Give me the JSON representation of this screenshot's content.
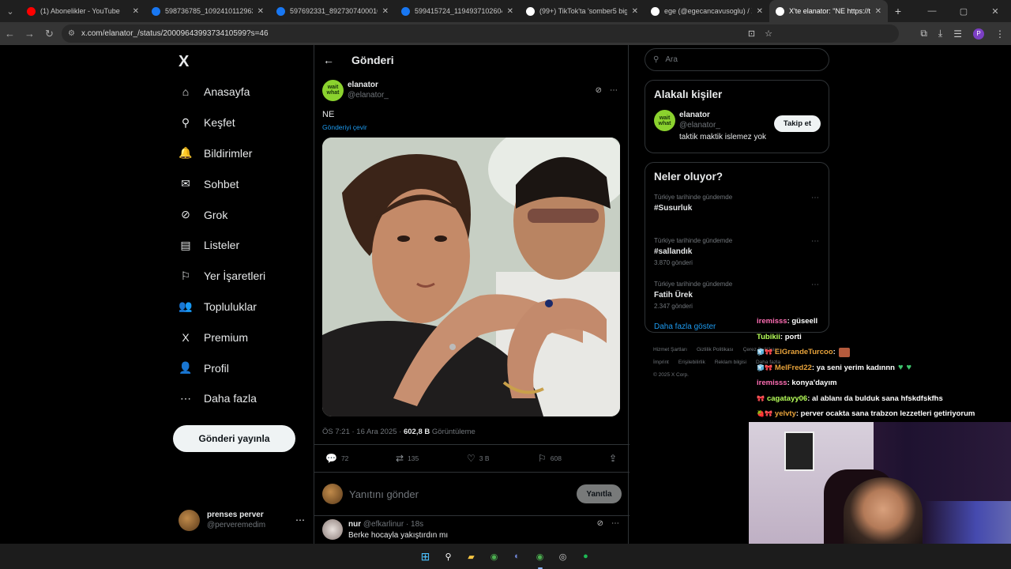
{
  "browser": {
    "tabs": [
      {
        "title": "(1) Abonelikler - YouTube",
        "icon": "youtube-icon",
        "color": "#ff0000",
        "active": false
      },
      {
        "title": "598736785_1092410112963637",
        "icon": "facebook-icon",
        "color": "#1877f2",
        "active": false
      },
      {
        "title": "597692331_8927307400016451",
        "icon": "facebook-icon",
        "color": "#1877f2",
        "active": false
      },
      {
        "title": "599415724_1194937102604271",
        "icon": "facebook-icon",
        "color": "#1877f2",
        "active": false
      },
      {
        "title": "(99+) TikTok'ta 'somber5 big5' s",
        "icon": "tiktok-icon",
        "color": "#ffffff",
        "active": false
      },
      {
        "title": "ege (@egecancavusoglu) / X",
        "icon": "x-icon",
        "color": "#ffffff",
        "active": false
      },
      {
        "title": "X'te elanator: \"NE https://t.co/i",
        "icon": "x-icon",
        "color": "#ffffff",
        "active": true
      }
    ],
    "url": "x.com/elanator_/status/2000964399373410599?s=46",
    "profile_initial": "P"
  },
  "sidebar": {
    "logo": "X",
    "items": [
      {
        "label": "Anasayfa",
        "icon": "home-icon",
        "glyph": "⌂"
      },
      {
        "label": "Keşfet",
        "icon": "search-icon",
        "glyph": "⚲"
      },
      {
        "label": "Bildirimler",
        "icon": "bell-icon",
        "glyph": "🔔"
      },
      {
        "label": "Sohbet",
        "icon": "mail-icon",
        "glyph": "✉"
      },
      {
        "label": "Grok",
        "icon": "grok-icon",
        "glyph": "⊘"
      },
      {
        "label": "Listeler",
        "icon": "list-icon",
        "glyph": "▤"
      },
      {
        "label": "Yer İşaretleri",
        "icon": "bookmark-icon",
        "glyph": "⚐"
      },
      {
        "label": "Topluluklar",
        "icon": "communities-icon",
        "glyph": "👥"
      },
      {
        "label": "Premium",
        "icon": "x-premium-icon",
        "glyph": "X"
      },
      {
        "label": "Profil",
        "icon": "profile-icon",
        "glyph": "👤"
      },
      {
        "label": "Daha fazla",
        "icon": "more-circle-icon",
        "glyph": "⋯"
      }
    ],
    "post_button": "Gönderi yayınla",
    "account": {
      "name": "prenses perver",
      "handle": "@perveremedim",
      "more": "⋯"
    }
  },
  "main": {
    "header": "Gönderi",
    "tweet": {
      "avatar_text": "wait what",
      "name": "elanator",
      "handle": "@elanator_",
      "text": "NE",
      "translate": "Gönderiyi çevir",
      "time": "ÖS 7:21 · 16 Ara 2025 · ",
      "views": "602,8 B",
      "views_label": " Görüntüleme",
      "replies": "72",
      "reposts": "135",
      "likes": "3 B",
      "bookmarks": "608"
    },
    "reply_placeholder": "Yanıtını gönder",
    "reply_button": "Yanıtla",
    "reply": {
      "name": "nur",
      "handle": "@efkarlinur · 18s",
      "text": "Berke hocayla yakıştırdın mı"
    }
  },
  "right": {
    "search_placeholder": "Ara",
    "related_title": "Alakalı kişiler",
    "related": {
      "name": "elanator",
      "handle": "@elanator_",
      "bio": "taktik maktik islemez yok",
      "follow": "Takip et"
    },
    "trends_title": "Neler oluyor?",
    "trends": [
      {
        "context": "Türkiye tarihinde gündemde",
        "name": "#Susurluk",
        "count": ""
      },
      {
        "context": "Türkiye tarihinde gündemde",
        "name": "#sallandık",
        "count": "3.870 gönderi"
      },
      {
        "context": "Türkiye tarihinde gündemde",
        "name": "Fatih Ürek",
        "count": "2.347 gönderi"
      }
    ],
    "show_more": "Daha fazla göster",
    "footer": [
      "Hizmet Şartları",
      "Gizlilik Politikası",
      "Çerez Politikası",
      "İmprint",
      "Erişilebilirlik",
      "Reklam bilgisi",
      "Daha fazla",
      "© 2025 X Corp."
    ]
  },
  "chat": [
    {
      "user": "iremisss",
      "color": "#ff6eb4",
      "msg": ": güseell",
      "badge": ""
    },
    {
      "user": "Tubikii",
      "color": "#b7ff5a",
      "msg": ": porti",
      "badge": ""
    },
    {
      "user": "ElGrandeTurcoo",
      "color": "#e8a33b",
      "msg": " :",
      "badge": "🧊🎀"
    },
    {
      "user": "MelFred22",
      "color": "#e8a33b",
      "msg": ": ya seni yerim kadınnn",
      "badge": "🧊🎀"
    },
    {
      "user": "iremisss",
      "color": "#ff6eb4",
      "msg": ": konya'dayım",
      "badge": ""
    },
    {
      "user": "cagatayy06",
      "color": "#b7ff5a",
      "msg": ": al ablanı da bulduk sana hfskdfskfhs",
      "badge": "🎀"
    },
    {
      "user": "yelvty",
      "color": "#e8a33b",
      "msg": ": perver ocakta sana trabzon lezzetleri getiriyorum",
      "badge": "🍓🎀"
    }
  ]
}
